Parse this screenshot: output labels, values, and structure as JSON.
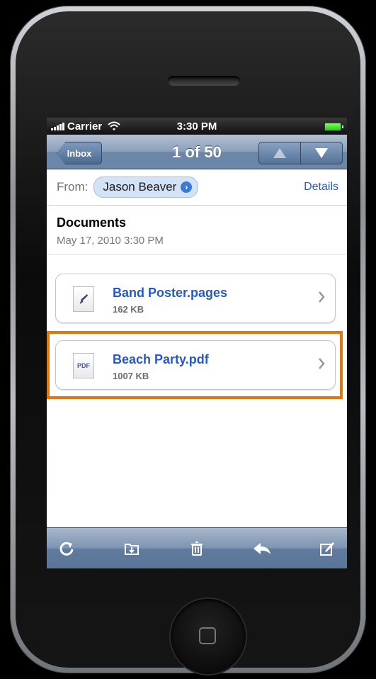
{
  "status_bar": {
    "carrier": "Carrier",
    "time": "3:30 PM"
  },
  "nav_bar": {
    "back_label": "Inbox",
    "title": "1 of 50",
    "previous_icon": "up-arrow-icon",
    "next_icon": "down-arrow-icon"
  },
  "header": {
    "from_label": "From:",
    "sender": "Jason Beaver",
    "details_label": "Details"
  },
  "message": {
    "subject": "Documents",
    "date": "May 17, 2010 3:30 PM"
  },
  "attachments": [
    {
      "name": "Band Poster.pages",
      "size": "162 KB",
      "icon": "pages-document-icon"
    },
    {
      "name": "Beach Party.pdf",
      "size": "1007 KB",
      "icon": "pdf-document-icon",
      "icon_text": "PDF"
    }
  ],
  "toolbar": {
    "items": [
      "refresh-icon",
      "move-to-folder-icon",
      "trash-icon",
      "reply-icon",
      "compose-icon"
    ]
  },
  "colors": {
    "highlight": "#e07a10",
    "link": "#2559c9",
    "nav_bar": "#6d87a9"
  }
}
